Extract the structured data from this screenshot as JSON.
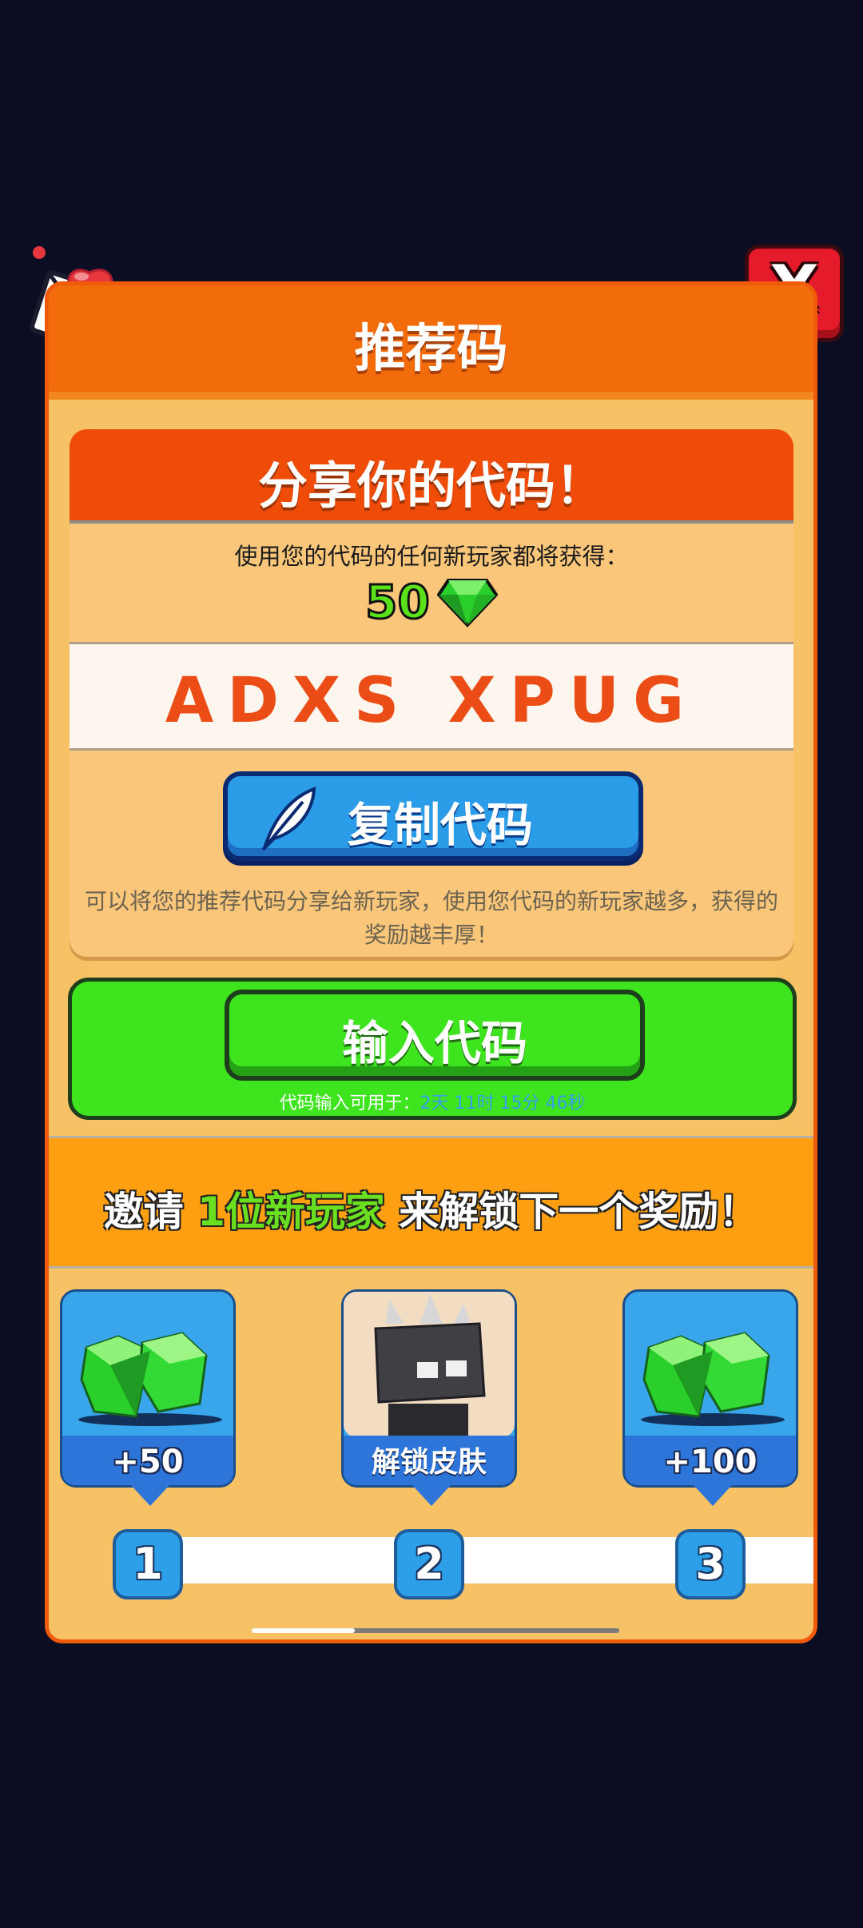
{
  "title": "推荐码",
  "share": {
    "title": "分享你的代码！",
    "caption": "使用您的代码的任何新玩家都将获得：",
    "reward_amount": "50",
    "code": "ADXS XPUG",
    "copy_label": "复制代码",
    "description": "可以将您的推荐代码分享给新玩家，使用您代码的新玩家越多，获得的奖励越丰厚！"
  },
  "enter": {
    "label": "输入代码",
    "timer_prefix": "代码输入可用于：",
    "timer_d": "2",
    "timer_d_unit": "天",
    "timer_h": "11",
    "timer_h_unit": "时",
    "timer_m": "15",
    "timer_m_unit": "分",
    "timer_s": "46",
    "timer_s_unit": "秒"
  },
  "invite": {
    "prefix": "邀请",
    "count": "1位",
    "who": "新玩家",
    "suffix": " 来解锁下一个奖励！"
  },
  "rewards": [
    {
      "label": "+50",
      "icon": "gem-pile-icon",
      "step": "1"
    },
    {
      "label": "解锁皮肤",
      "icon": "skin-character-icon",
      "step": "2"
    },
    {
      "label": "+100",
      "icon": "gem-pile-icon",
      "step": "3"
    }
  ],
  "progress": {
    "scroll_fraction": 0.28
  },
  "colors": {
    "accent_orange": "#f26c0c",
    "gem_green": "#3ee41e",
    "code_red": "#ec4d16",
    "button_blue": "#2b9ce8",
    "close_red": "#e51b2b"
  }
}
